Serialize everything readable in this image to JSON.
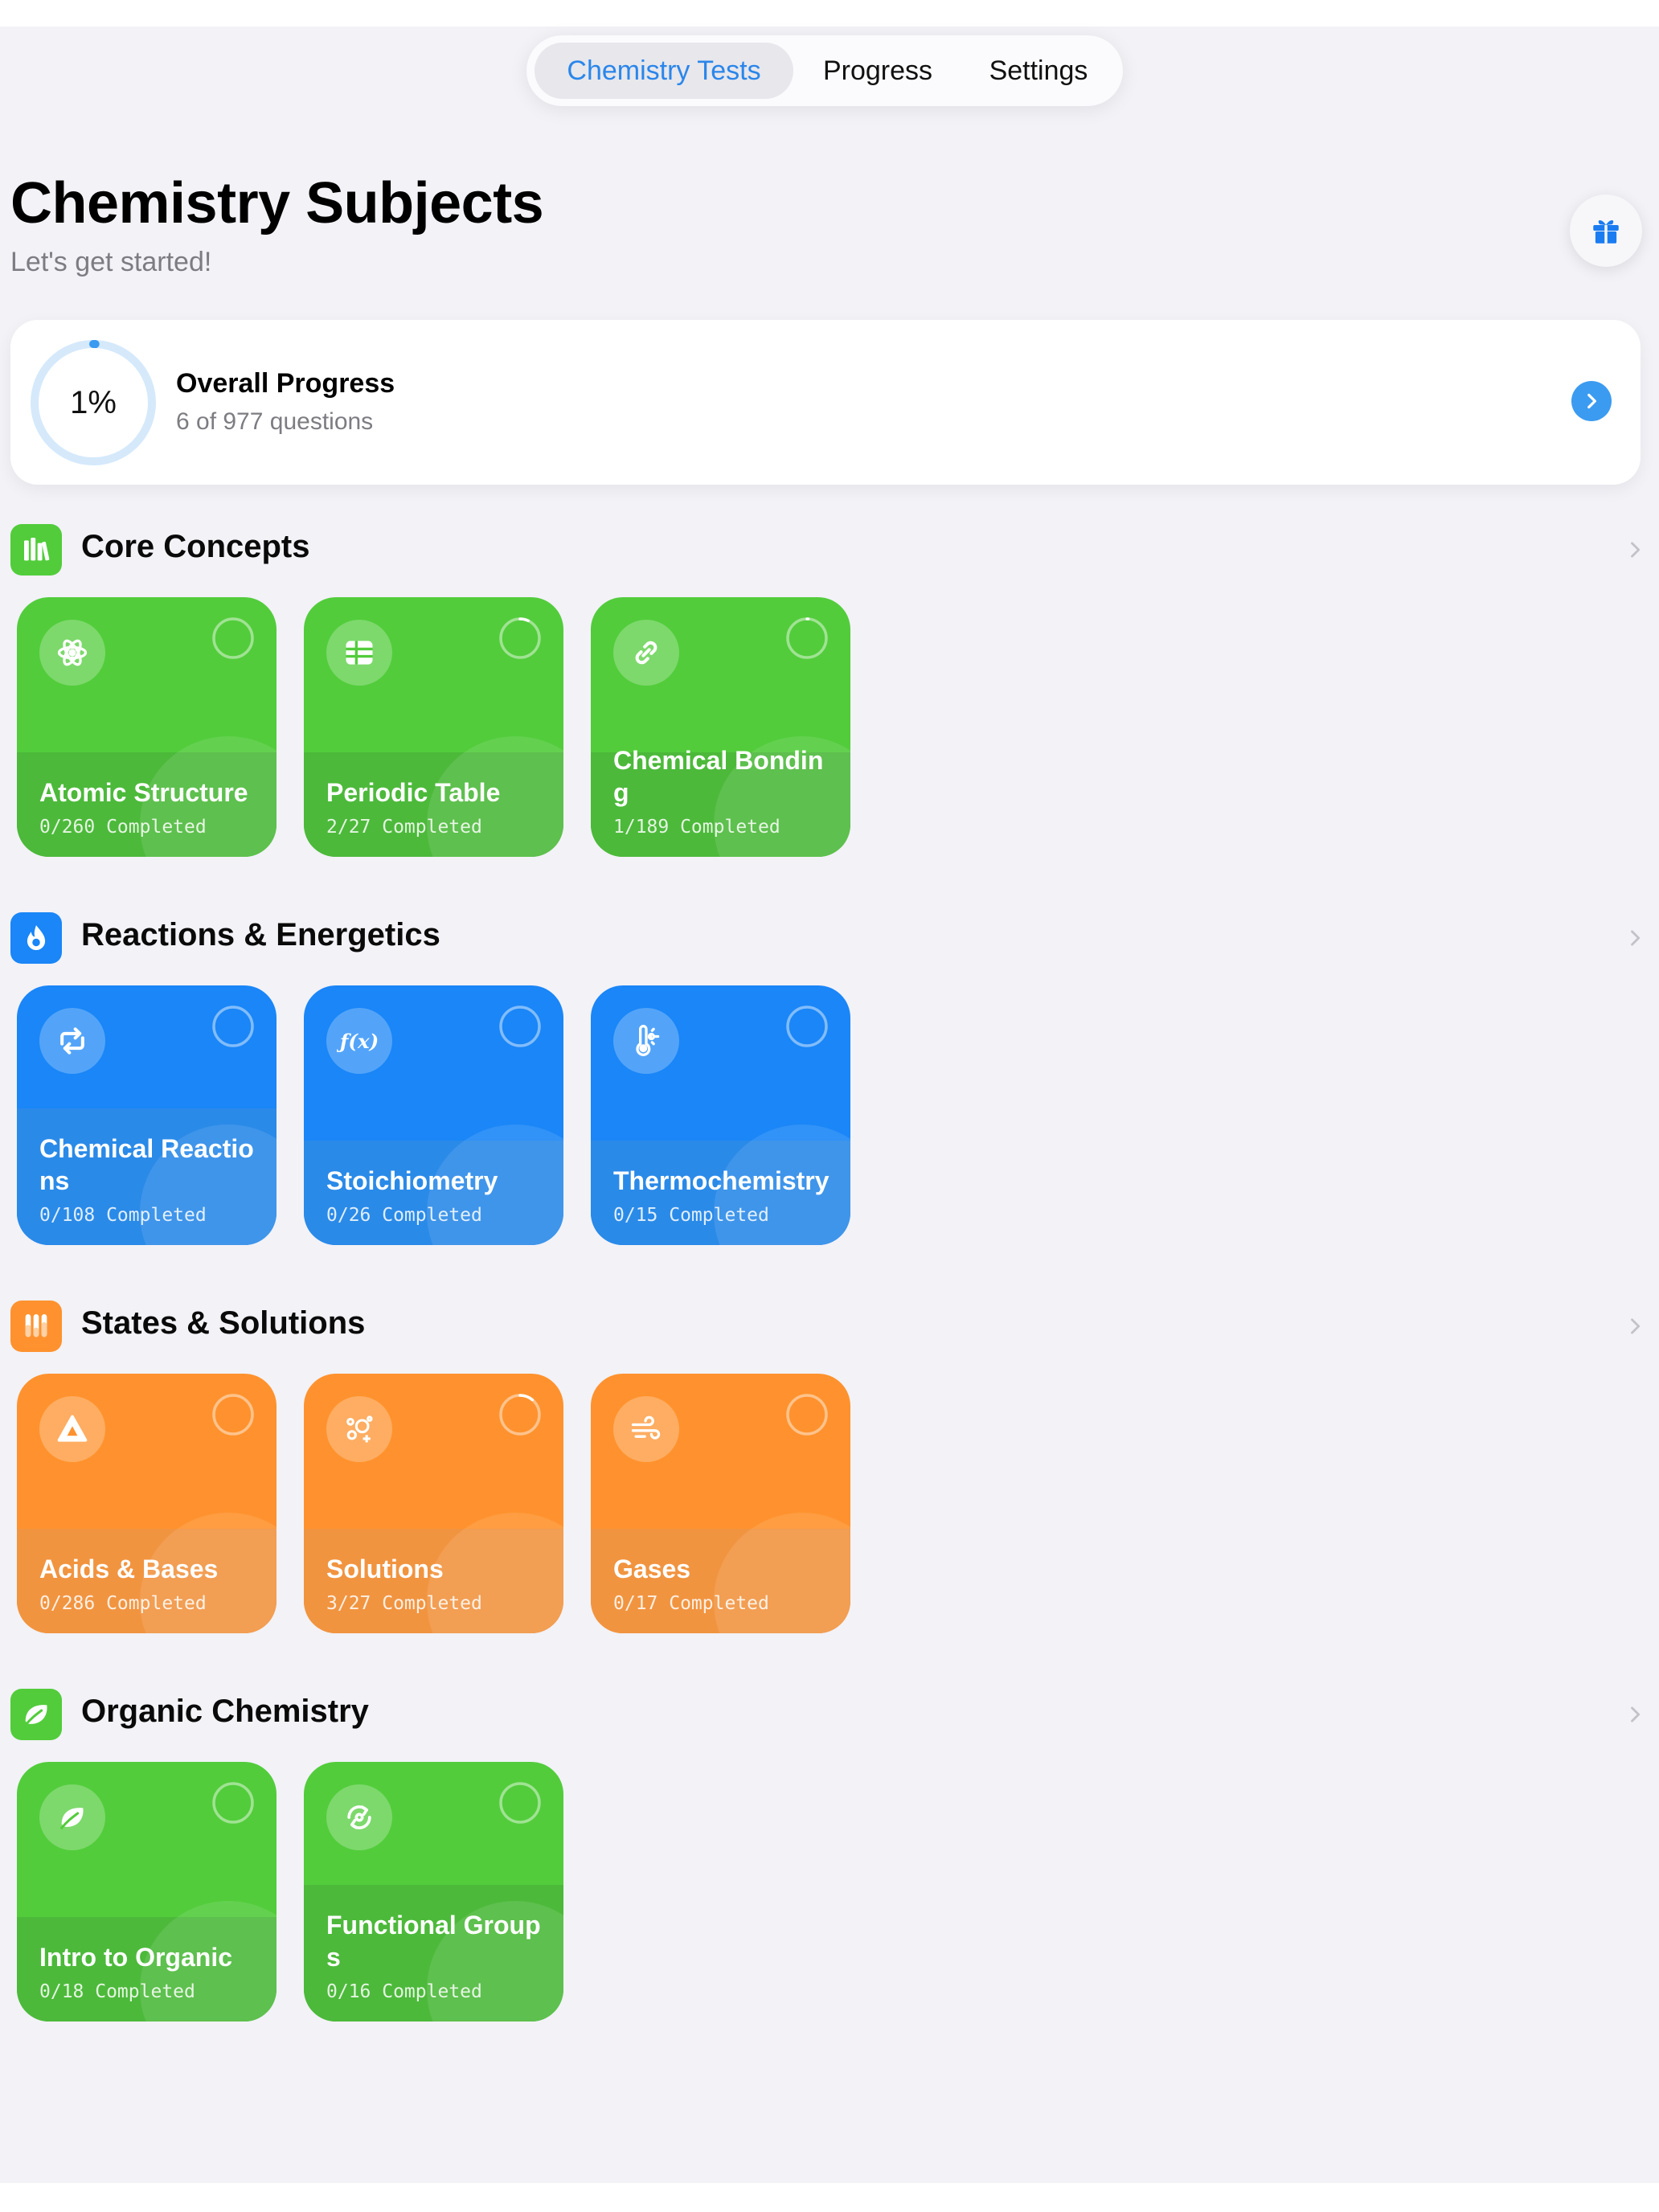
{
  "tabs": [
    {
      "label": "Chemistry Tests",
      "active": true
    },
    {
      "label": "Progress",
      "active": false
    },
    {
      "label": "Settings",
      "active": false
    }
  ],
  "header": {
    "title": "Chemistry Subjects",
    "subtitle": "Let's get started!",
    "gift_icon": "gift-icon"
  },
  "overall": {
    "percent_label": "1%",
    "percent_value": 0.006,
    "title": "Overall Progress",
    "subtitle": "6 of 977 questions",
    "accent": "#3b9bf0"
  },
  "sections": [
    {
      "title": "Core Concepts",
      "color": "#52cc3b",
      "icon": "books-icon",
      "cards": [
        {
          "name": "Atomic Structure",
          "count": "0/260 Completed",
          "icon": "atom-icon",
          "progress": 0.0
        },
        {
          "name": "Periodic Table",
          "count": "2/27 Completed",
          "icon": "grid-icon",
          "progress": 0.07
        },
        {
          "name": "Chemical Bonding",
          "count": "1/189 Completed",
          "icon": "link-icon",
          "progress": 0.01
        }
      ]
    },
    {
      "title": "Reactions & Energetics",
      "color": "#1a86f7",
      "icon": "flame-icon",
      "cards": [
        {
          "name": "Chemical Reactions",
          "count": "0/108 Completed",
          "icon": "repeat-icon",
          "progress": 0.0
        },
        {
          "name": "Stoichiometry",
          "count": "0/26 Completed",
          "icon": "function-icon",
          "progress": 0.0
        },
        {
          "name": "Thermochemistry",
          "count": "0/15 Completed",
          "icon": "thermometer-icon",
          "progress": 0.0
        }
      ]
    },
    {
      "title": "States & Solutions",
      "color": "#ff922e",
      "icon": "test-tubes-icon",
      "cards": [
        {
          "name": "Acids & Bases",
          "count": "0/286 Completed",
          "icon": "triangle-icon",
          "progress": 0.0
        },
        {
          "name": "Solutions",
          "count": "3/27 Completed",
          "icon": "bubbles-icon",
          "progress": 0.11
        },
        {
          "name": "Gases",
          "count": "0/17 Completed",
          "icon": "wind-icon",
          "progress": 0.0
        }
      ]
    },
    {
      "title": "Organic Chemistry",
      "color": "#52cc3b",
      "icon": "leaf-icon",
      "cards": [
        {
          "name": "Intro to Organic",
          "count": "0/18 Completed",
          "icon": "leaf-icon",
          "progress": 0.0
        },
        {
          "name": "Functional Groups",
          "count": "0/16 Completed",
          "icon": "cycle-icon",
          "progress": 0.0
        }
      ]
    }
  ]
}
